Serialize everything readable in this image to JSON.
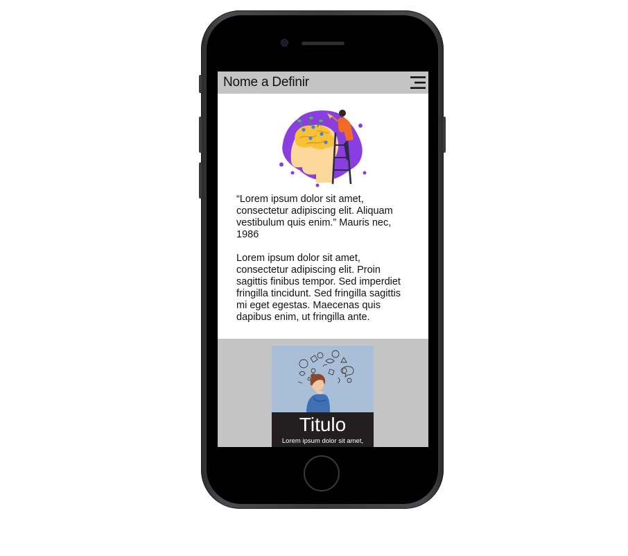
{
  "app_bar": {
    "title": "Nome a Definir",
    "menu_icon": "menu-icon"
  },
  "hero": {
    "icon": "mind-growth-illustration",
    "colors": {
      "purple": "#8a3ee0",
      "skin": "#fbd79b",
      "brain": "#f7c236",
      "person": "#f06a2a"
    }
  },
  "content": {
    "quote": "“Lorem ipsum dolor sit amet, consectetur adipiscing elit. Aliquam vestibulum quis enim.” Mauris nec, 1986",
    "body": "Lorem ipsum dolor sit amet, consectetur adipiscing elit. Proin sagittis finibus tempor. Sed imperdiet fringilla tincidunt. Sed fringilla sagittis mi eget egestas. Maecenas quis dapibus enim, ut fringilla ante."
  },
  "card": {
    "title": "Titulo",
    "text": "Lorem ipsum dolor sit amet,",
    "image_icon": "thinking-woman-illustration",
    "image_bg": "#a9bfd8"
  },
  "colors": {
    "app_bar": "#c4c4c4",
    "card_body": "#231f20",
    "phone": "#3a3a3d"
  }
}
